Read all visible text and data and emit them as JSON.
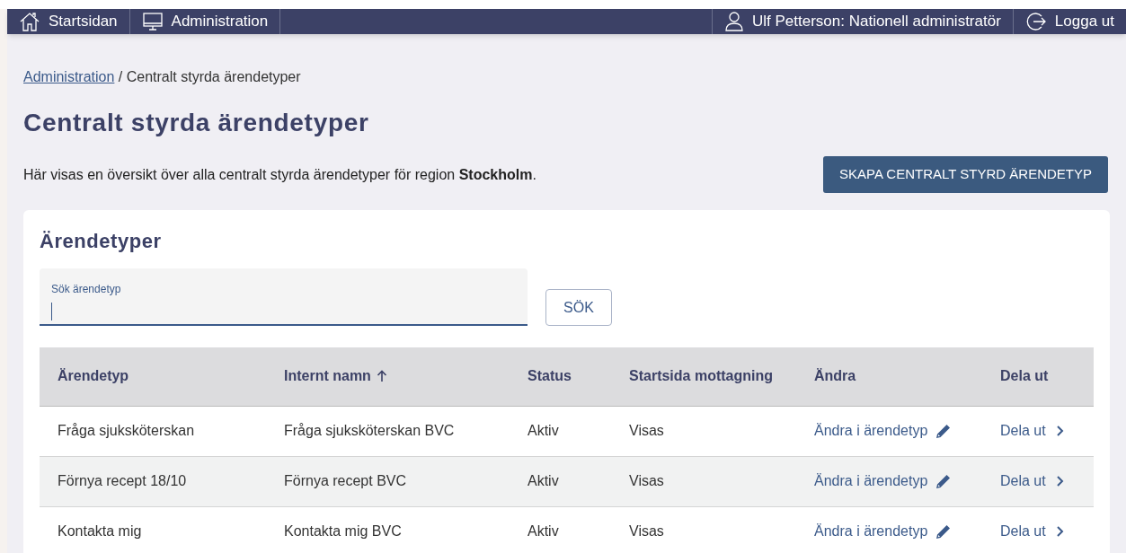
{
  "nav": {
    "left": [
      {
        "kind": "home",
        "label": "Startsidan"
      },
      {
        "kind": "monitor",
        "label": "Administration"
      }
    ],
    "right": [
      {
        "kind": "user",
        "label": "Ulf Petterson: Nationell administratör"
      },
      {
        "kind": "logout",
        "label": "Logga ut"
      }
    ]
  },
  "breadcrumb": {
    "link": "Administration",
    "current": "/ Centralt styrda ärendetyper"
  },
  "title": "Centralt styrda ärendetyper",
  "description": "Här visas en översikt över alla centralt styrda ärendetyper för region **Stockholm**.",
  "create_button": "SKAPA CENTRALT STYRD ÄRENDETYP",
  "card": {
    "title": "Ärendetyper",
    "search": {
      "label": "Sök ärendetyp",
      "button": "SÖK"
    },
    "table": {
      "columns": [
        {
          "label": "Ärendetyp",
          "sorted": false
        },
        {
          "label": "Internt namn",
          "sorted": true
        },
        {
          "label": "Status",
          "sorted": false
        },
        {
          "label": "Startsida mottagning",
          "sorted": false
        },
        {
          "label": "Ändra",
          "sorted": false
        },
        {
          "label": "Dela ut",
          "sorted": false
        }
      ],
      "rows": [
        {
          "name": "Fråga sjuksköterskan",
          "internal": "Fråga sjuksköterskan BVC",
          "status": "Aktiv",
          "start": "Visas",
          "edit": "Ändra i ärendetyp",
          "share": "Dela ut"
        },
        {
          "name": "Förnya recept 18/10",
          "internal": "Förnya recept BVC",
          "status": "Aktiv",
          "start": "Visas",
          "edit": "Ändra i ärendetyp",
          "share": "Dela ut"
        },
        {
          "name": "Kontakta mig",
          "internal": "Kontakta mig BVC",
          "status": "Aktiv",
          "start": "Visas",
          "edit": "Ändra i ärendetyp",
          "share": "Dela ut"
        }
      ]
    }
  }
}
